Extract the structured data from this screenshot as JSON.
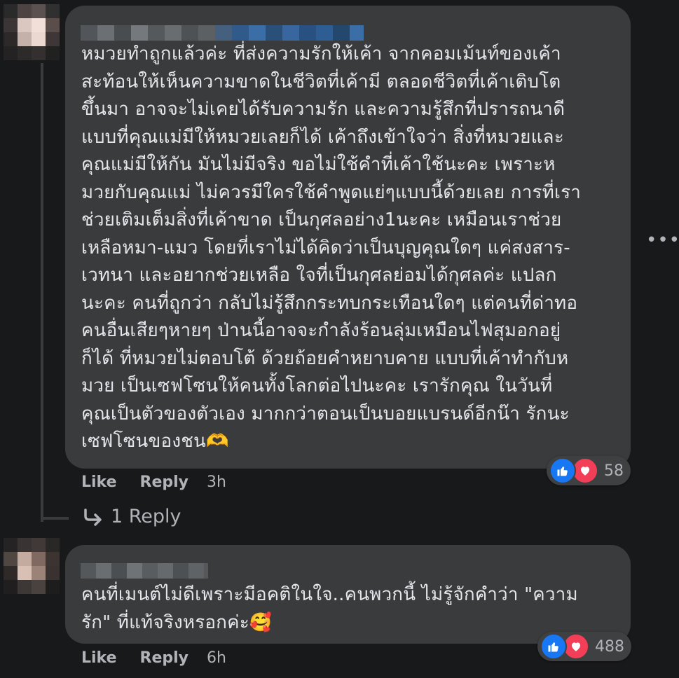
{
  "comments": [
    {
      "text": "หมวยทำถูกแล้วค่ะ ที่ส่งความรักให้เค้า จากคอมเม้นท์ของเค้า\nสะท้อนให้เห็นความขาดในชีวิตที่เค้ามี ตลอดชีวิตที่เค้าเติบโต\nขึ้นมา อาจจะไม่เคยได้รับความรัก และความรู้สึกที่ปรารถนาดี\nแบบที่คุณแม่มีให้หมวยเลยก็ได้ เค้าถึงเข้าใจว่า สิ่งที่หมวยและ\nคุณแม่มีให้กัน มันไม่มีจริง ขอไม่ใช้คำที่เค้าใช้นะคะ เพราะห\nมวยกับคุณแม่ ไม่ควรมีใครใช้คำพูดแย่ๆแบบนี้ด้วยเลย การที่เรา\nช่วยเติมเต็มสิ่งที่เค้าขาด เป็นกุศลอย่าง1นะคะ เหมือนเราช่วย\nเหลือหมา-แมว โดยที่เราไม่ได้คิดว่าเป็นบุญคุณใดๆ แค่สงสาร-\nเวทนา และอยากช่วยเหลือ ใจที่เป็นกุศลย่อมได้กุศลค่ะ แปลก\nนะคะ คนที่ถูกว่า กลับไม่รู้สึกกระทบกระเทือนใดๆ แต่คนที่ด่าทอ\nคนอื่นเสียๆหายๆ ป่านนี้อาจจะกำลังร้อนลุ่มเหมือนไฟสุมอกอยู่\nก็ได้ ที่หมวยไม่ตอบโต้ ด้วยถ้อยคำหยาบคาย แบบที่เค้าทำกับห\nมวย เป็นเซฟโซนให้คนทั้งโลกต่อไปนะคะ เรารักคุณ ในวันที่\nคุณเป็นตัวของตัวเอง มากกว่าตอนเป็นบอยแบรนด์อีกน๊า รักนะ\nเซฟโซนของชน🫶",
      "like_label": "Like",
      "reply_label": "Reply",
      "time": "3h",
      "reaction_count": "58",
      "reply_count_label": "1 Reply"
    },
    {
      "text": "คนที่เมนต์ไม่ดีเพราะมีอคติในใจ..คนพวกนี้ ไม่รู้จักคำว่า \"ความ\nรัก\" ที่แท้จริงหรอกค่ะ🥰",
      "like_label": "Like",
      "reply_label": "Reply",
      "time": "6h",
      "reaction_count": "488"
    }
  ],
  "more_options": "•••",
  "icons": {
    "like": "thumbs-up-icon",
    "love": "heart-icon",
    "reply_arrow": "reply-arrow-icon",
    "more": "more-options-icon"
  },
  "colors": {
    "background": "#18191a",
    "bubble": "#3a3b3c",
    "text": "#e4e6eb",
    "secondary_text": "#b0b3b8",
    "like_blue": "#1877f2",
    "love_red": "#f33e58"
  }
}
